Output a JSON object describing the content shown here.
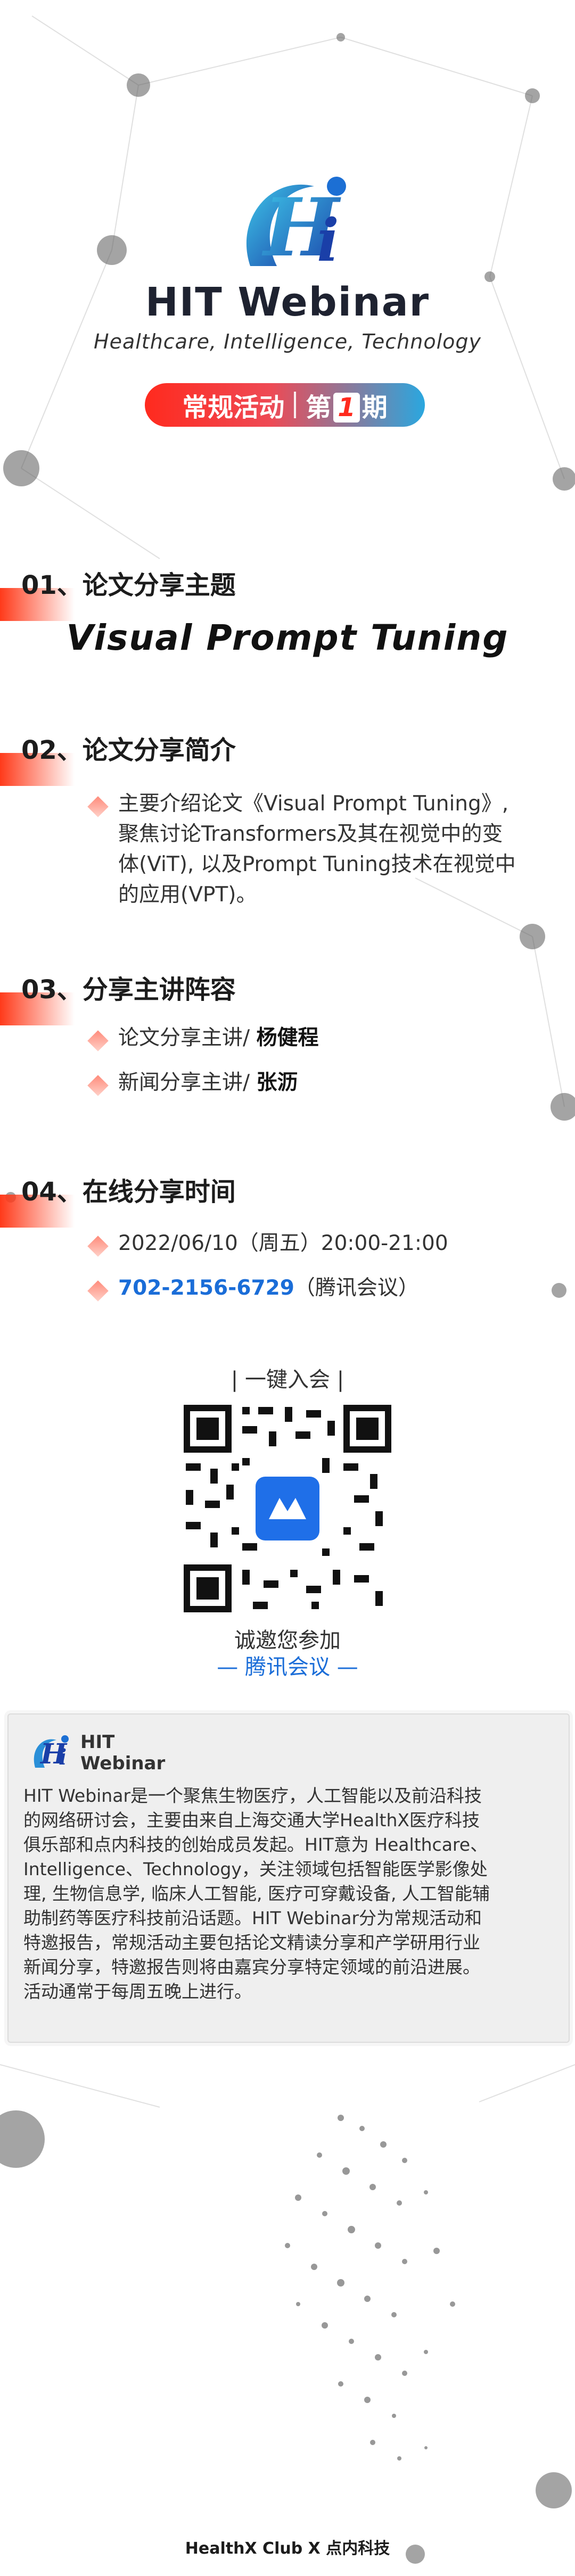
{
  "header": {
    "logo_mark": "Hi",
    "title": "HIT Webinar",
    "subtitle": "Healthcare, Intelligence, Technology",
    "badge_left": "常规活动",
    "badge_prefix": "第",
    "badge_num": "1",
    "badge_suffix": "期"
  },
  "sections": [
    {
      "head": "01、论文分享主题",
      "paper": "Visual Prompt Tuning"
    },
    {
      "head": "02、论文分享简介",
      "intro": [
        "主要介绍论文《Visual Prompt Tuning》,",
        "聚焦讨论Transformers及其在视觉中的变",
        "体(ViT), 以及Prompt Tuning技术在视觉中",
        "的应用(VPT)。"
      ]
    },
    {
      "head": "03、分享主讲阵容",
      "speakers": [
        {
          "label": "论文分享主讲/ ",
          "name": "杨健程"
        },
        {
          "label": "新闻分享主讲/ ",
          "name": "张沥"
        }
      ]
    },
    {
      "head": "04、在线分享时间",
      "time": "2022/06/10（周五）20:00-21:00",
      "meeting_id": "702-2156-6729",
      "meeting_app": "（腾讯会议）"
    }
  ],
  "qr": {
    "label": "| 一键入会 |",
    "invite": "诚邀您参加",
    "app": "— 腾讯会议 —"
  },
  "about": {
    "name_line1": "HIT",
    "name_line2": "Webinar",
    "text": [
      "HIT Webinar是一个聚焦生物医疗，人工智能以及前沿科技",
      "的网络研讨会，主要由来自上海交通大学HealthX医疗科技",
      "俱乐部和点内科技的创始成员发起。HIT意为 Healthcare、",
      "Intelligence、Technology，关注领域包括智能医学影像处",
      "理, 生物信息学, 临床人工智能, 医疗可穿戴设备, 人工智能辅",
      "助制药等医疗科技前沿话题。HIT Webinar分为常规活动和",
      "特邀报告，常规活动主要包括论文精读分享和产学研用行业",
      "新闻分享，特邀报告则将由嘉宾分享特定领域的前沿进展。",
      "活动通常于每周五晚上进行。"
    ]
  },
  "footer": "HealthX Club X 点内科技",
  "colors": {
    "accent_red": "#ff2a1e",
    "accent_blue": "#2aa7df",
    "link_blue": "#1a6dd8"
  }
}
